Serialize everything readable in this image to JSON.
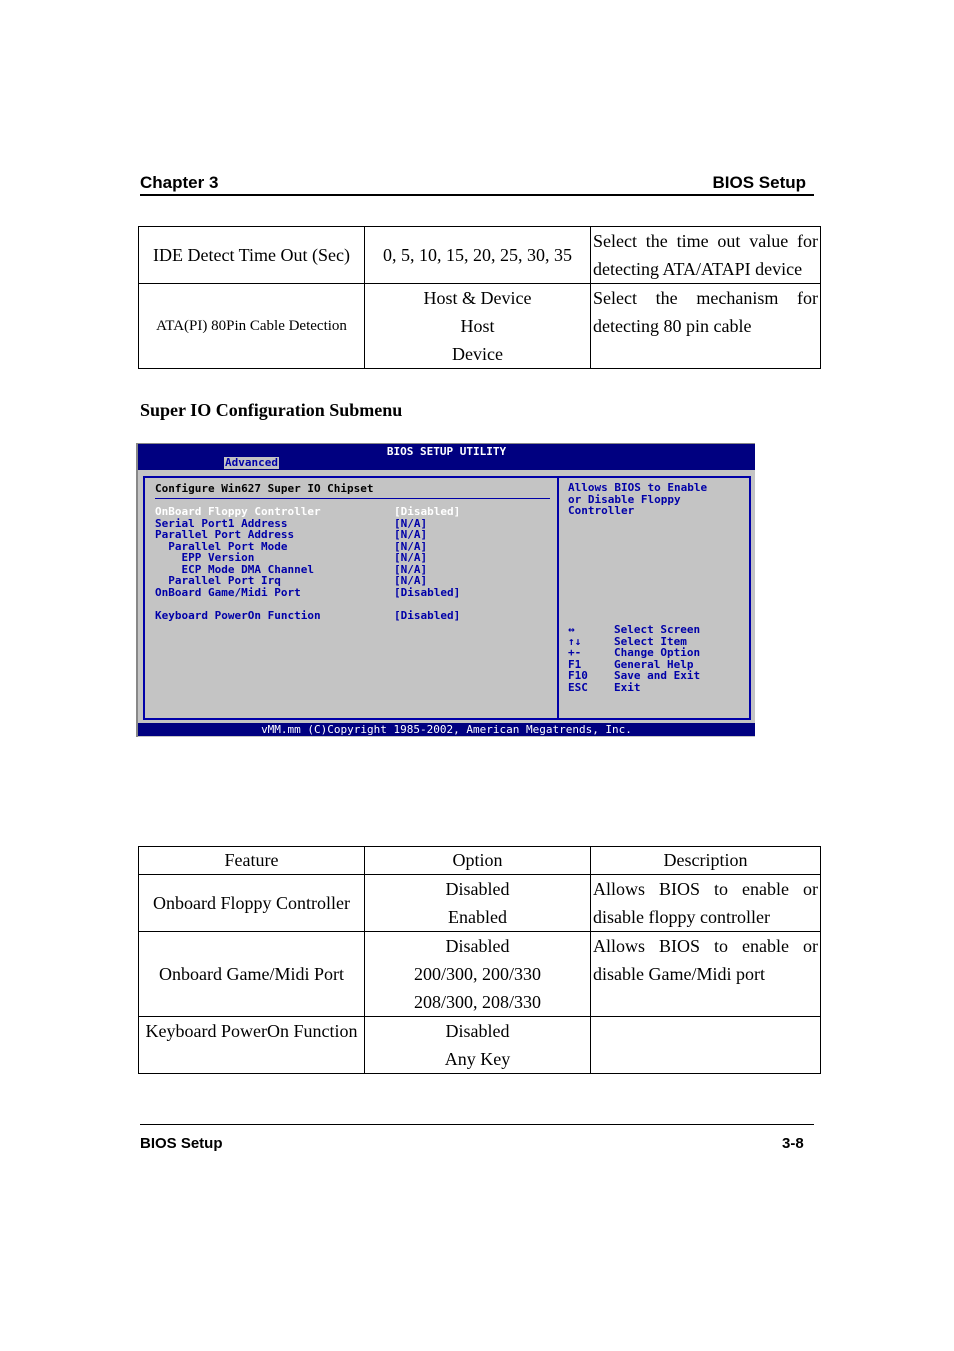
{
  "header": {
    "left": "Chapter 3",
    "right": "BIOS Setup"
  },
  "table1": {
    "rows": [
      {
        "feature": "IDE Detect Time Out (Sec)",
        "options": [
          "0, 5, 10, 15, 20, 25, 30, 35"
        ],
        "description": [
          "Select the time out value for",
          "detecting ATA/ATAPI device"
        ]
      },
      {
        "feature": "ATA(PI) 80Pin Cable Detection",
        "options": [
          "Host & Device",
          "Host",
          "Device"
        ],
        "description": [
          "Select the mechanism for",
          "detecting 80 pin cable"
        ]
      }
    ]
  },
  "section_title": "Super IO Configuration Submenu",
  "bios": {
    "title": "BIOS SETUP UTILITY",
    "active_tab": "Advanced",
    "heading": "Configure Win627 Super IO Chipset",
    "items": [
      {
        "label": "OnBoard Floppy Controller",
        "value": "[Disabled]",
        "selected": true
      },
      {
        "label": "Serial Port1 Address",
        "value": "[N/A]"
      },
      {
        "label": "Parallel Port Address",
        "value": "[N/A]"
      },
      {
        "label": "  Parallel Port Mode",
        "value": "[N/A]"
      },
      {
        "label": "    EPP Version",
        "value": "[N/A]"
      },
      {
        "label": "    ECP Mode DMA Channel",
        "value": "[N/A]"
      },
      {
        "label": "  Parallel Port Irq",
        "value": "[N/A]"
      },
      {
        "label": "OnBoard Game/Midi Port",
        "value": "[Disabled]"
      },
      {
        "label": "Keyboard PowerOn Function",
        "value": "[Disabled]"
      }
    ],
    "help_text": [
      "Allows BIOS to Enable",
      "or Disable Floppy",
      "Controller"
    ],
    "keys": [
      {
        "key": "↔",
        "action": "Select Screen"
      },
      {
        "key": "↑↓",
        "action": "Select Item"
      },
      {
        "key": "+-",
        "action": "Change Option"
      },
      {
        "key": "F1",
        "action": "General Help"
      },
      {
        "key": "F10",
        "action": "Save and Exit"
      },
      {
        "key": "ESC",
        "action": "Exit"
      }
    ],
    "footer": "vMM.mm (C)Copyright 1985-2002, American Megatrends, Inc.",
    "colors": {
      "title_bg": "#000080",
      "panel_bg": "#c4c4c4",
      "text": "#0000a8",
      "selected_text": "#ffffff"
    }
  },
  "table2": {
    "headers": [
      "Feature",
      "Option",
      "Description"
    ],
    "rows": [
      {
        "feature": "Onboard Floppy Controller",
        "options": [
          "Disabled",
          "Enabled"
        ],
        "description": [
          "Allows BIOS to enable or",
          "disable floppy controller"
        ]
      },
      {
        "feature": "Onboard Game/Midi Port",
        "options": [
          "Disabled",
          "200/300, 200/330",
          "208/300, 208/330"
        ],
        "description": [
          "Allows BIOS to enable or",
          "disable Game/Midi port"
        ]
      },
      {
        "feature": "Keyboard PowerOn Function",
        "options": [
          "Disabled",
          "Any Key"
        ],
        "description": []
      }
    ]
  },
  "footer": {
    "left": "BIOS Setup",
    "right": "3-8"
  }
}
